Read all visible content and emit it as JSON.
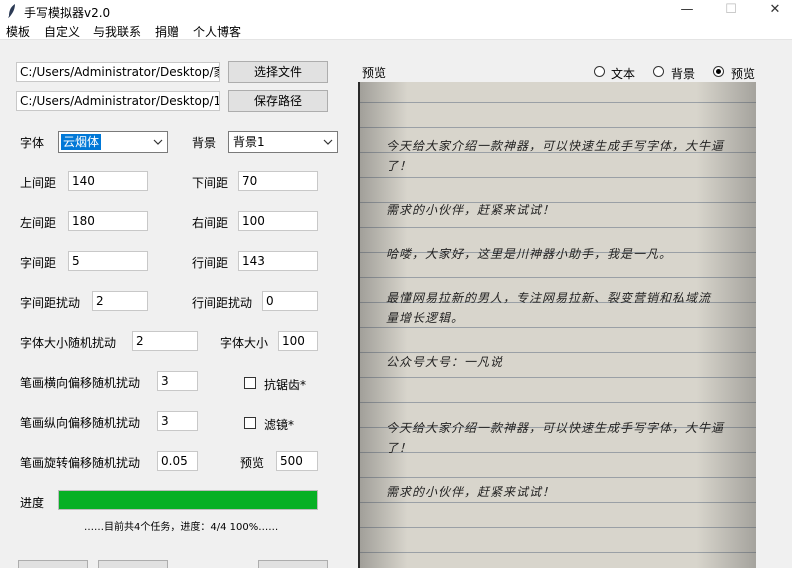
{
  "window": {
    "title": "手写模拟器v2.0",
    "min_symbol": "—",
    "max_symbol": "☐",
    "close_symbol": "✕"
  },
  "menu": [
    "模板",
    "自定义",
    "与我联系",
    "捐赠",
    "个人博客"
  ],
  "files": {
    "input_path": "C:/Users/Administrator/Desktop/家",
    "output_path": "C:/Users/Administrator/Desktop/1",
    "choose_file_label": "选择文件",
    "save_path_label": "保存路径"
  },
  "font": {
    "label": "字体",
    "value": "云烟体"
  },
  "background": {
    "label": "背景",
    "value": "背景1"
  },
  "fields": {
    "top_margin": {
      "label": "上间距",
      "value": "140"
    },
    "bottom_margin": {
      "label": "下间距",
      "value": "70"
    },
    "left_margin": {
      "label": "左间距",
      "value": "180"
    },
    "right_margin": {
      "label": "右间距",
      "value": "100"
    },
    "char_spacing": {
      "label": "字间距",
      "value": "5"
    },
    "line_spacing": {
      "label": "行间距",
      "value": "143"
    },
    "char_spacing_jitter": {
      "label": "字间距扰动",
      "value": "2"
    },
    "line_spacing_jitter": {
      "label": "行间距扰动",
      "value": "0"
    },
    "font_size_jitter": {
      "label": "字体大小随机扰动",
      "value": "2"
    },
    "font_size": {
      "label": "字体大小",
      "value": "100"
    },
    "stroke_h_jitter": {
      "label": "笔画横向偏移随机扰动",
      "value": "3"
    },
    "stroke_v_jitter": {
      "label": "笔画纵向偏移随机扰动",
      "value": "3"
    },
    "stroke_rot_jitter": {
      "label": "笔画旋转偏移随机扰动",
      "value": "0.05"
    },
    "preview_size": {
      "label": "预览",
      "value": "500"
    }
  },
  "checkboxes": {
    "antialias": {
      "label": "抗锯齿*",
      "checked": false
    },
    "filter": {
      "label": "滤镜*",
      "checked": false
    }
  },
  "preview_panel": {
    "label": "预览",
    "modes": [
      {
        "label": "文本",
        "selected": false
      },
      {
        "label": "背景",
        "selected": false
      },
      {
        "label": "预览",
        "selected": true
      }
    ],
    "lines": [
      "今天给大家介绍一款神器，可以快速生成手写字体，大牛逼",
      "了！",
      "需求的小伙伴，赶紧来试试！",
      "哈喽，大家好，这里是川神器小助手，我是一凡。",
      "最懂网易拉新的男人，专注网易拉新、裂变营销和私域流",
      "量增长逻辑。",
      "公众号大号：一凡说",
      "今天给大家介绍一款神器，可以快速生成手写字体，大牛逼",
      "了！",
      "需求的小伙伴，赶紧来试试！"
    ]
  },
  "progress": {
    "label": "进度",
    "fraction": 1.0,
    "status": "……目前共4个任务，进度：4/4  100%……"
  }
}
